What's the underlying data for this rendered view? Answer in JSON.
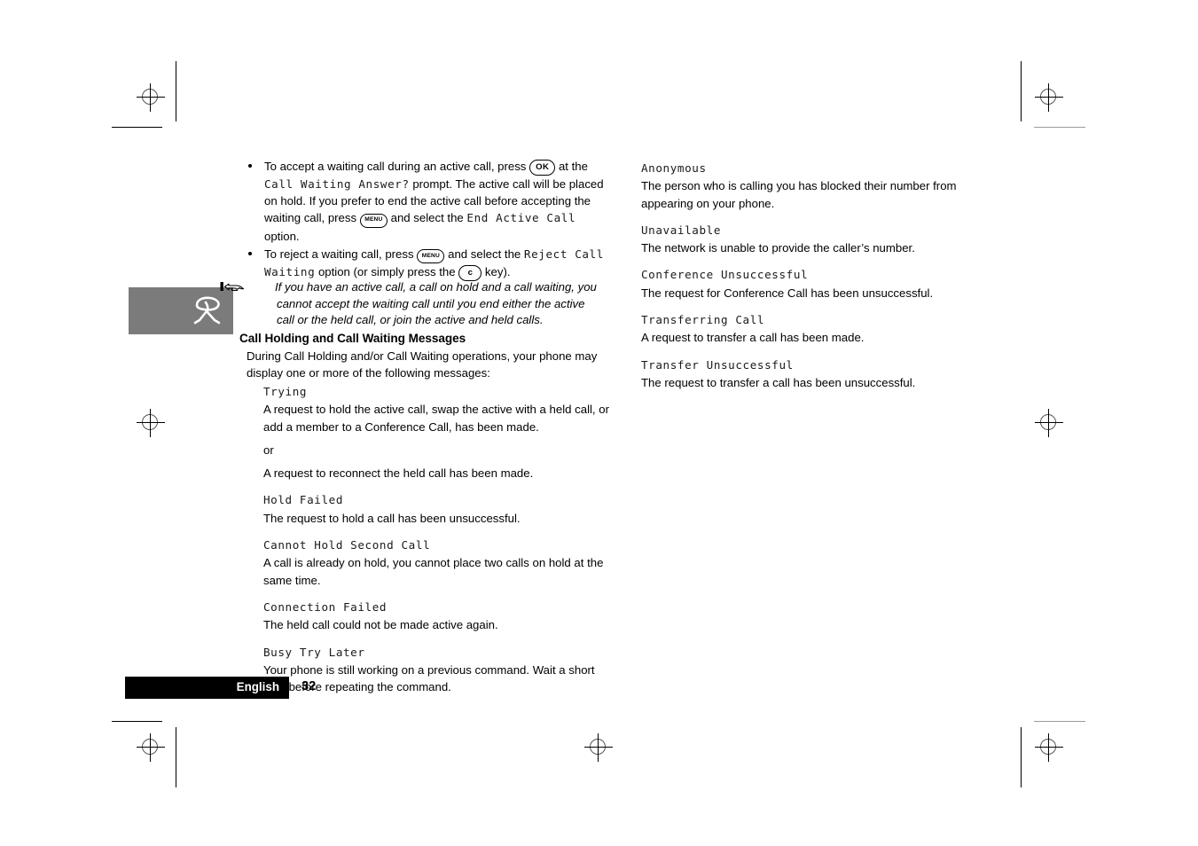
{
  "page": {
    "language_label": "English",
    "page_number": "32"
  },
  "bullets": [
    {
      "parts": [
        {
          "type": "text",
          "value": "To accept a waiting call during an active call, press "
        },
        {
          "type": "key",
          "value": "OK"
        },
        {
          "type": "text",
          "value": " at the "
        },
        {
          "type": "lcd",
          "value": "Call Waiting Answer?"
        },
        {
          "type": "text",
          "value": " prompt. The active call will be placed on hold. If you prefer to end the active call before accepting the waiting call, press "
        },
        {
          "type": "key",
          "value": "MENU"
        },
        {
          "type": "text",
          "value": " and select the "
        },
        {
          "type": "lcd",
          "value": "End Active Call"
        },
        {
          "type": "text",
          "value": " option."
        }
      ]
    },
    {
      "parts": [
        {
          "type": "text",
          "value": "To reject a waiting call, press "
        },
        {
          "type": "key",
          "value": "MENU"
        },
        {
          "type": "text",
          "value": " and select the "
        },
        {
          "type": "lcd",
          "value": "Reject Call Waiting"
        },
        {
          "type": "text",
          "value": " option (or simply press the "
        },
        {
          "type": "key",
          "value": "c"
        },
        {
          "type": "text",
          "value": " key)."
        }
      ]
    }
  ],
  "note": {
    "icon": "pointing-hand-icon",
    "text": "If you have an active call, a call on hold and a call waiting, you cannot accept the waiting call until you end either the active call or the held call, or join the active and held calls."
  },
  "sidebar_icon": {
    "name": "phone-handset-icon",
    "background_color": "#7b7b7b",
    "icon_color": "#ffffff"
  },
  "section": {
    "heading": "Call Holding and Call Waiting Messages",
    "intro": "During Call Holding and/or Call Waiting operations, your phone may display one or more of the following messages:"
  },
  "messages_left": [
    {
      "term": "Trying",
      "descriptions": [
        "A request to hold the active call, swap the active with a held call, or add a member to a Conference Call, has been made.",
        "or",
        "A request to reconnect the held call has been made."
      ]
    },
    {
      "term": "Hold Failed",
      "descriptions": [
        "The request to hold a call has been unsuccessful."
      ]
    },
    {
      "term": "Cannot Hold Second Call",
      "descriptions": [
        "A call is already on hold, you cannot place two calls on hold at the same time."
      ]
    },
    {
      "term": "Connection Failed",
      "descriptions": [
        "The held call could not be made active again."
      ]
    },
    {
      "term": "Busy Try Later",
      "descriptions": [
        "Your phone is still working on a previous command. Wait a short time before repeating the command."
      ]
    }
  ],
  "messages_right": [
    {
      "term": "Anonymous",
      "descriptions": [
        "The person who is calling you has blocked their number from appearing on your phone."
      ]
    },
    {
      "term": "Unavailable",
      "descriptions": [
        "The network is unable to provide the caller’s number."
      ]
    },
    {
      "term": "Conference Unsuccessful",
      "descriptions": [
        "The request for Conference Call has been unsuccessful."
      ]
    },
    {
      "term": "Transferring Call",
      "descriptions": [
        "A request to transfer a call has been made."
      ]
    },
    {
      "term": "Transfer Unsuccessful",
      "descriptions": [
        "The request to transfer a call has been unsuccessful."
      ]
    }
  ],
  "print_marks": {
    "registration_mark_count": 8,
    "crop_mark_count": 8
  }
}
